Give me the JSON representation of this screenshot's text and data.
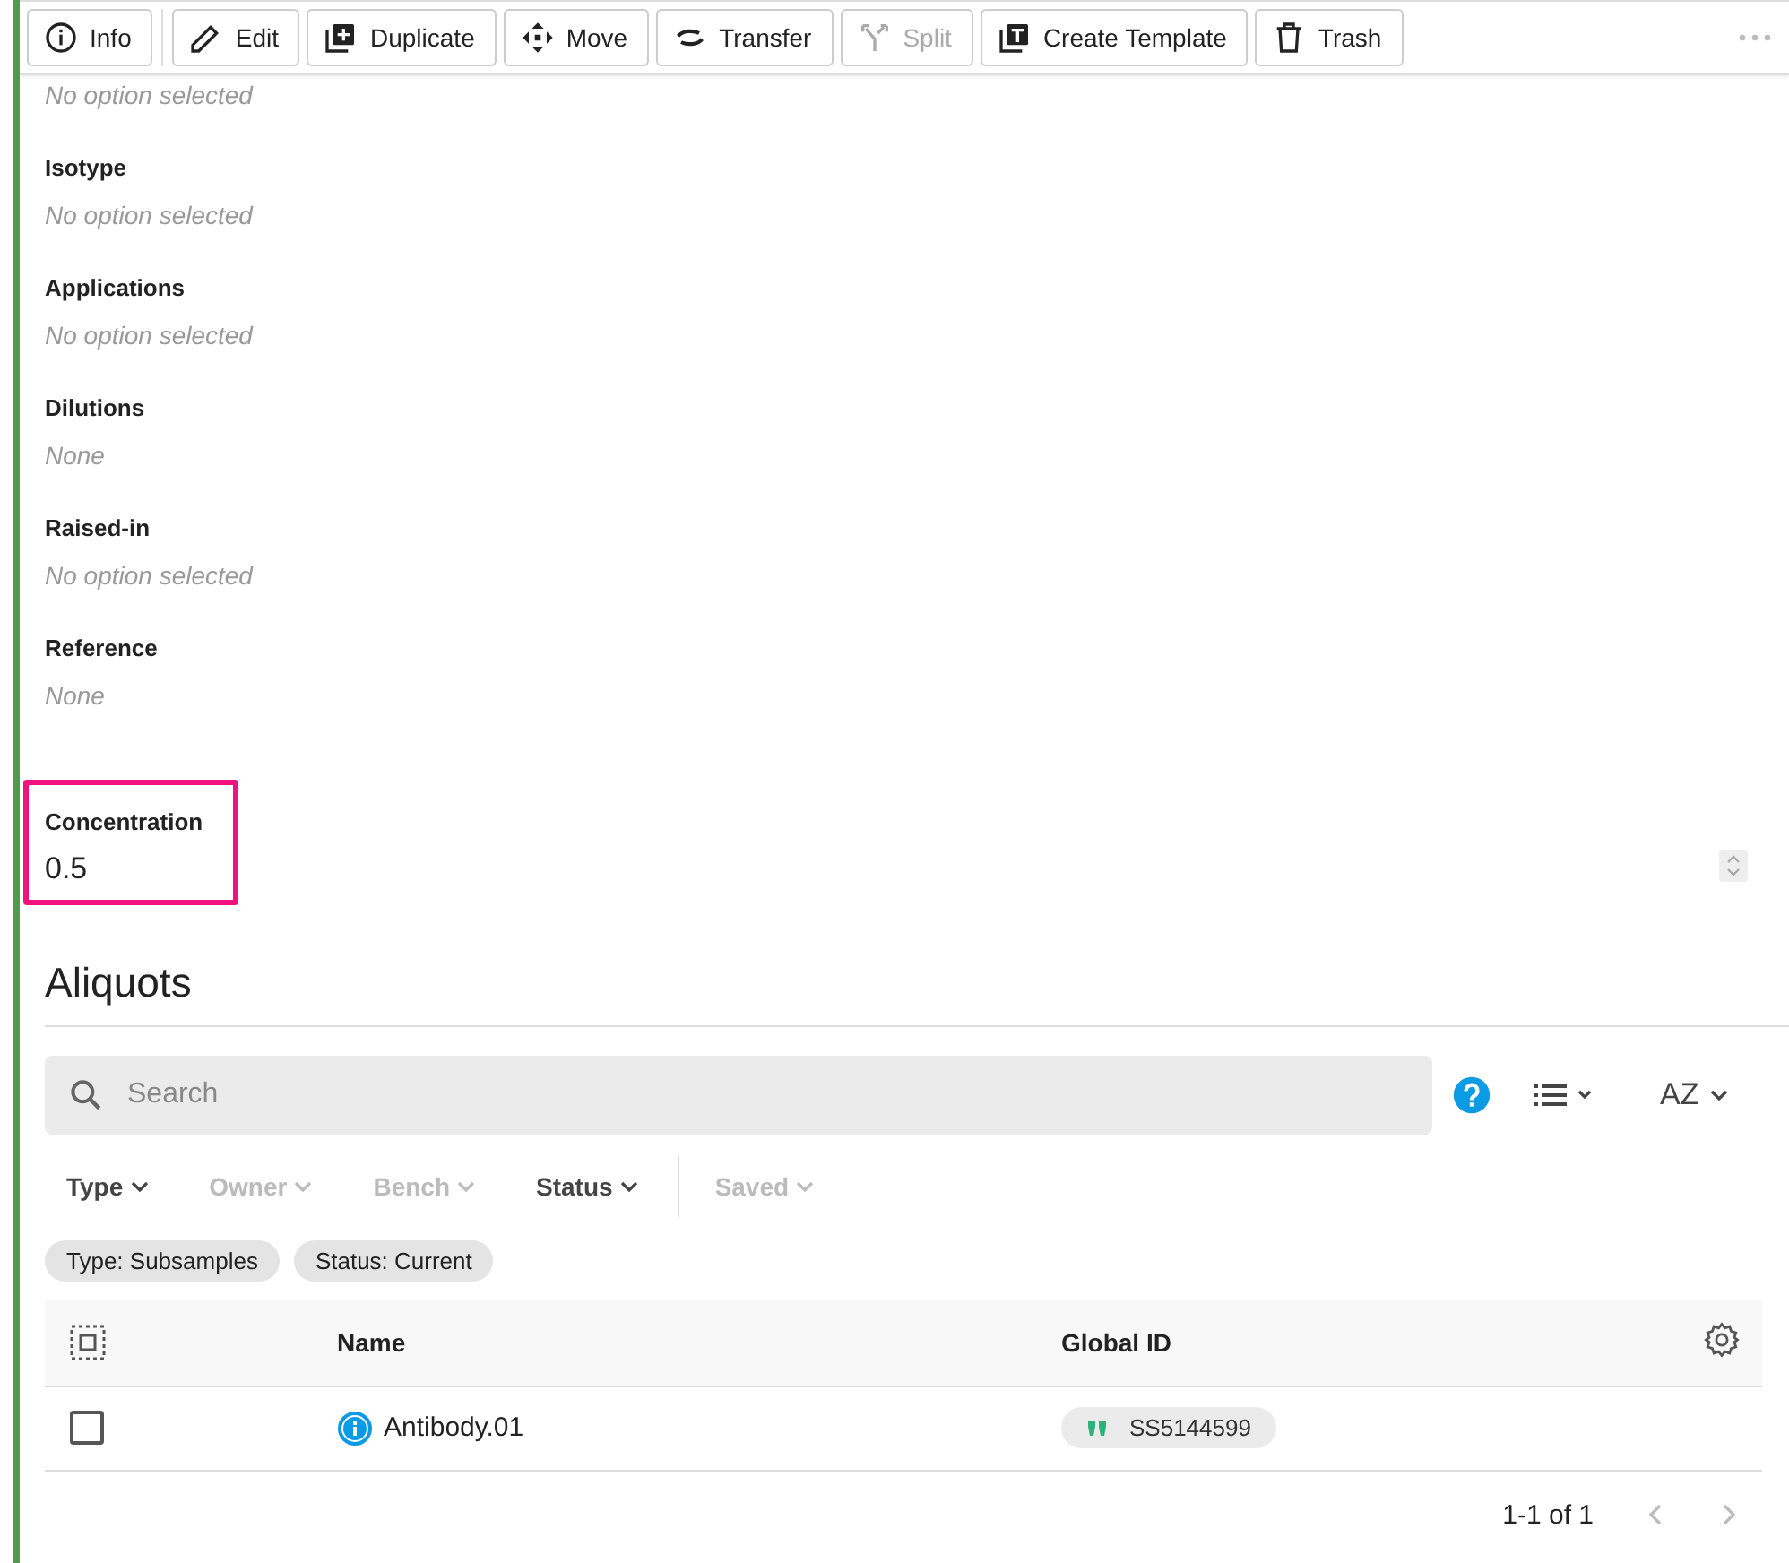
{
  "toolbar": {
    "buttons": [
      {
        "label": "Info",
        "disabled": false
      },
      {
        "label": "Edit",
        "disabled": false
      },
      {
        "label": "Duplicate",
        "disabled": false
      },
      {
        "label": "Move",
        "disabled": false
      },
      {
        "label": "Transfer",
        "disabled": false
      },
      {
        "label": "Split",
        "disabled": true
      },
      {
        "label": "Create Template",
        "disabled": false
      },
      {
        "label": "Trash",
        "disabled": false
      }
    ]
  },
  "fields": [
    {
      "value": "No option selected",
      "empty": true,
      "highlighted": false,
      "kind": "text"
    },
    {
      "label": "Isotype",
      "value": "No option selected",
      "empty": true,
      "highlighted": false,
      "kind": "text"
    },
    {
      "label": "Applications",
      "value": "No option selected",
      "empty": true,
      "highlighted": false,
      "kind": "text"
    },
    {
      "label": "Dilutions",
      "value": "None",
      "empty": true,
      "highlighted": false,
      "kind": "text"
    },
    {
      "label": "Raised-in",
      "value": "No option selected",
      "empty": true,
      "highlighted": false,
      "kind": "text"
    },
    {
      "label": "Reference",
      "value": "None",
      "empty": true,
      "highlighted": false,
      "kind": "text"
    },
    {
      "label": "Concentration",
      "value": "0.5",
      "empty": false,
      "highlighted": true,
      "kind": "number"
    }
  ],
  "aliquots": {
    "title": "Aliquots",
    "search": {
      "placeholder": "Search"
    },
    "sort": "AZ",
    "filters": [
      {
        "label": "Type",
        "enabled": true
      },
      {
        "label": "Owner",
        "enabled": false
      },
      {
        "label": "Bench",
        "enabled": false
      },
      {
        "label": "Status",
        "enabled": true
      },
      {
        "label": "Saved",
        "enabled": false
      }
    ],
    "chips": [
      "Type: Subsamples",
      "Status: Current"
    ],
    "columns": [
      "Name",
      "Global ID"
    ],
    "rows": [
      {
        "name": "Antibody.01",
        "global_id": "SS5144599",
        "checked": false
      }
    ],
    "pagination": "1-1 of 1"
  }
}
